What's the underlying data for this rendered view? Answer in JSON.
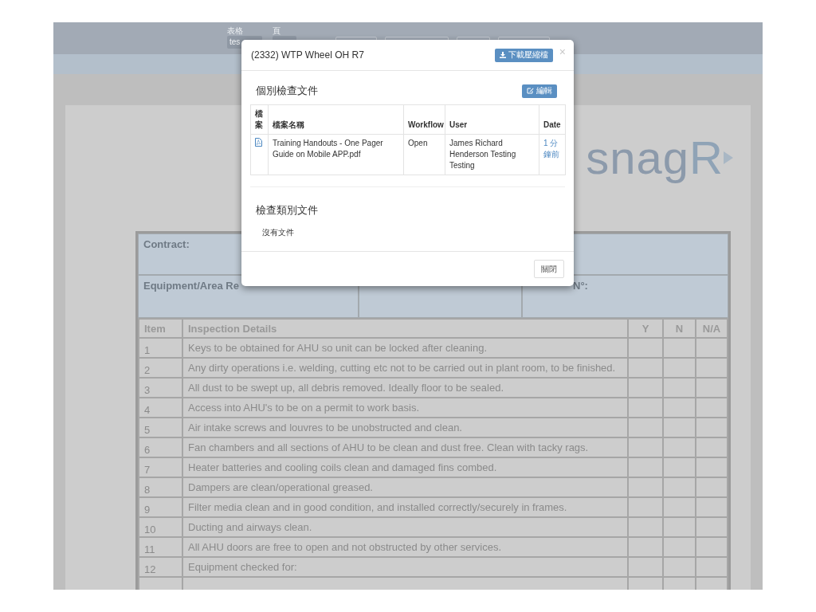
{
  "top_bar": {
    "fields": [
      {
        "label": "表格",
        "value": "tes"
      },
      {
        "label": "頁"
      }
    ]
  },
  "sheet": {
    "logo": {
      "text": "snag",
      "accent": "R"
    },
    "contract_label": "Contract:",
    "equipment_label": "Equipment/Area Re",
    "serial_label": "N°:",
    "columns": [
      "Item",
      "Inspection Details",
      "Y",
      "N",
      "N/A"
    ],
    "rows": [
      {
        "item": "1",
        "detail": "Keys to be obtained for AHU so unit can be locked after cleaning."
      },
      {
        "item": "2",
        "detail": "Any dirty operations i.e. welding, cutting etc not to be carried out in plant room, to be finished."
      },
      {
        "item": "3",
        "detail": "All dust to be swept up, all debris removed.  Ideally floor to be sealed."
      },
      {
        "item": "4",
        "detail": "Access into AHU's to be on a permit to work basis."
      },
      {
        "item": "5",
        "detail": "Air intake screws and louvres to be unobstructed and clean."
      },
      {
        "item": "6",
        "detail": "Fan chambers and all sections of AHU to be clean and dust free.  Clean with tacky rags."
      },
      {
        "item": "7",
        "detail": "Heater batteries and cooling coils clean and damaged fins combed."
      },
      {
        "item": "8",
        "detail": "Dampers are clean/operational greased."
      },
      {
        "item": "9",
        "detail": "Filter media clean and in good condition, and installed correctly/securely in frames."
      },
      {
        "item": "10",
        "detail": "Ducting and airways clean."
      },
      {
        "item": "11",
        "detail": "All AHU doors are free to open and not obstructed by other services."
      },
      {
        "item": "12",
        "detail": "Equipment checked for:"
      }
    ]
  },
  "modal": {
    "title": "(2332) WTP Wheel OH R7",
    "download_button": "下載壓縮檔",
    "close_icon": "×",
    "files_section": {
      "title": "個別檢查文件",
      "edit_button": "編輯",
      "columns": [
        "檔案",
        "檔案名稱",
        "Workflow",
        "User",
        "Date"
      ],
      "rows": [
        {
          "file_name": "Training Handouts - One Pager Guide on Mobile APP.pdf",
          "workflow": "Open",
          "user": "James Richard Henderson Testing Testing",
          "date": "1 分鐘前"
        }
      ]
    },
    "category_section": {
      "title": "檢查類別文件",
      "empty_text": "沒有文件"
    },
    "close_button": "關閉"
  }
}
